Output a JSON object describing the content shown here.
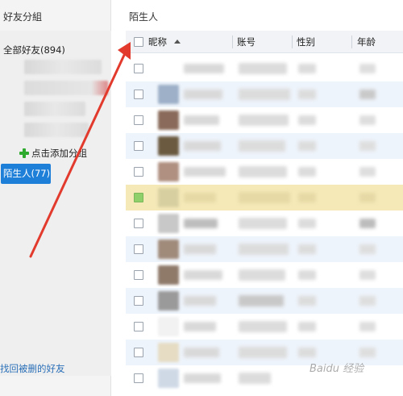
{
  "left_panel": {
    "title": "好友分組",
    "all_friends": "全部好友(894)",
    "add_group": "点击添加分组",
    "strangers": "陌生人(77)",
    "recover_link": "找回被删的好友"
  },
  "right_panel": {
    "title": "陌生人",
    "columns": {
      "nickname": "昵称",
      "account": "账号",
      "gender": "性别",
      "age": "年龄"
    }
  },
  "row_count": 13,
  "selected_row": 5,
  "colors": {
    "accent": "#1e7fd8",
    "selected_row": "#f5e9b8",
    "alt_row": "#eef4fb",
    "arrow": "#e23b2e"
  },
  "watermark": "Baidu 经验"
}
